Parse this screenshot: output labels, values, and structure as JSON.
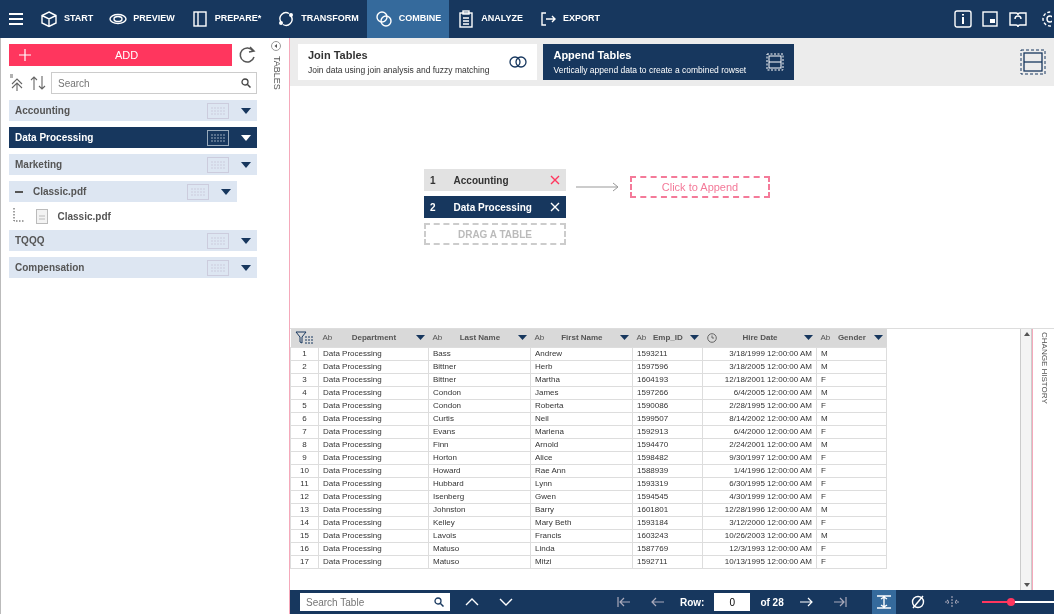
{
  "toolbar": {
    "tabs": [
      {
        "label": "START",
        "selected": false
      },
      {
        "label": "PREVIEW",
        "selected": false
      },
      {
        "label": "PREPARE*",
        "selected": false
      },
      {
        "label": "TRANSFORM",
        "selected": false
      },
      {
        "label": "COMBINE",
        "selected": true
      },
      {
        "label": "ANALYZE",
        "selected": false
      },
      {
        "label": "EXPORT",
        "selected": false
      }
    ]
  },
  "sidebar": {
    "add_button": "ADD",
    "search": {
      "placeholder": "Search"
    },
    "side_tab": "TABLES",
    "items": [
      {
        "label": "Accounting",
        "selected": false,
        "expanded": false
      },
      {
        "label": "Data Processing",
        "selected": true,
        "expanded": false
      },
      {
        "label": "Marketing",
        "selected": false,
        "expanded": false
      },
      {
        "label": "Classic.pdf",
        "selected": false,
        "expanded": true,
        "children": [
          {
            "label": "Classic.pdf"
          }
        ]
      },
      {
        "label": "TQQQ",
        "selected": false,
        "expanded": false
      },
      {
        "label": "Compensation",
        "selected": false,
        "expanded": false
      }
    ]
  },
  "modes": [
    {
      "title": "Join Tables",
      "subtitle": "Join data using join analysis and fuzzy matching",
      "selected": false
    },
    {
      "title": "Append Tables",
      "subtitle": "Vertically append data to create a combined rowset",
      "selected": true
    }
  ],
  "append": {
    "tables": [
      {
        "index": "1",
        "label": "Accounting",
        "selected": false
      },
      {
        "index": "2",
        "label": "Data Processing",
        "selected": true
      }
    ],
    "drop_hint": "DRAG A TABLE",
    "target": "Click to Append"
  },
  "grid": {
    "columns": [
      {
        "kind": "text",
        "type_label": "Ab",
        "label": "Department"
      },
      {
        "kind": "text",
        "type_label": "Ab",
        "label": "Last Name"
      },
      {
        "kind": "text",
        "type_label": "Ab",
        "label": "First Name"
      },
      {
        "kind": "text",
        "type_label": "Ab",
        "label": "Emp_ID"
      },
      {
        "kind": "date",
        "label": "Hire Date"
      },
      {
        "kind": "text",
        "type_label": "Ab",
        "label": "Gender"
      }
    ],
    "rows": [
      {
        "number": "1",
        "cells": [
          "Data Processing",
          "Bass",
          "Andrew",
          "1593211",
          "3/18/1999 12:00:00 AM",
          "M"
        ]
      },
      {
        "number": "2",
        "cells": [
          "Data Processing",
          "Bittner",
          "Herb",
          "1597596",
          "3/18/2005 12:00:00 AM",
          "M"
        ]
      },
      {
        "number": "3",
        "cells": [
          "Data Processing",
          "Bittner",
          "Martha",
          "1604193",
          "12/18/2001 12:00:00 AM",
          "F"
        ]
      },
      {
        "number": "4",
        "cells": [
          "Data Processing",
          "Condon",
          "James",
          "1597266",
          "6/4/2005 12:00:00 AM",
          "M"
        ]
      },
      {
        "number": "5",
        "cells": [
          "Data Processing",
          "Condon",
          "Roberta",
          "1590086",
          "2/28/1995 12:00:00 AM",
          "F"
        ]
      },
      {
        "number": "6",
        "cells": [
          "Data Processing",
          "Curtis",
          "Neil",
          "1599507",
          "8/14/2002 12:00:00 AM",
          "M"
        ]
      },
      {
        "number": "7",
        "cells": [
          "Data Processing",
          "Evans",
          "Marlena",
          "1592913",
          "6/4/2000 12:00:00 AM",
          "F"
        ]
      },
      {
        "number": "8",
        "cells": [
          "Data Processing",
          "Finn",
          "Arnold",
          "1594470",
          "2/24/2001 12:00:00 AM",
          "M"
        ]
      },
      {
        "number": "9",
        "cells": [
          "Data Processing",
          "Horton",
          "Alice",
          "1598482",
          "9/30/1997 12:00:00 AM",
          "F"
        ]
      },
      {
        "number": "10",
        "cells": [
          "Data Processing",
          "Howard",
          "Rae Ann",
          "1588939",
          "1/4/1996 12:00:00 AM",
          "F"
        ]
      },
      {
        "number": "11",
        "cells": [
          "Data Processing",
          "Hubbard",
          "Lynn",
          "1593319",
          "6/30/1995 12:00:00 AM",
          "F"
        ]
      },
      {
        "number": "12",
        "cells": [
          "Data Processing",
          "Isenberg",
          "Gwen",
          "1594545",
          "4/30/1999 12:00:00 AM",
          "F"
        ]
      },
      {
        "number": "13",
        "cells": [
          "Data Processing",
          "Johnston",
          "Barry",
          "1601801",
          "12/28/1996 12:00:00 AM",
          "M"
        ]
      },
      {
        "number": "14",
        "cells": [
          "Data Processing",
          "Kelley",
          "Mary Beth",
          "1593184",
          "3/12/2000 12:00:00 AM",
          "F"
        ]
      },
      {
        "number": "15",
        "cells": [
          "Data Processing",
          "Lavois",
          "Francis",
          "1603243",
          "10/26/2003 12:00:00 AM",
          "M"
        ]
      },
      {
        "number": "16",
        "cells": [
          "Data Processing",
          "Matuso",
          "Linda",
          "1587769",
          "12/3/1993 12:00:00 AM",
          "F"
        ]
      },
      {
        "number": "17",
        "cells": [
          "Data Processing",
          "Matuso",
          "Mitzi",
          "1592711",
          "10/13/1995 12:00:00 AM",
          "F"
        ]
      }
    ]
  },
  "side_panel": {
    "label": "CHANGE HISTORY"
  },
  "bottom_bar": {
    "search": {
      "placeholder": "Search Table"
    },
    "row_label": "Row:",
    "row_value": "0",
    "row_total": "of 28",
    "zoom": {
      "level": 0.4
    }
  }
}
